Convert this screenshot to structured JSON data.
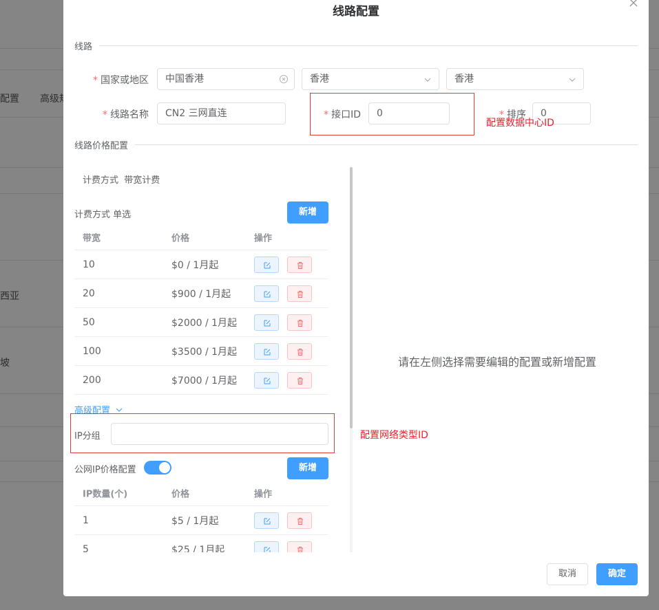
{
  "background": {
    "texts": [
      "配置",
      "高级规",
      "西亚",
      "坡"
    ]
  },
  "modal": {
    "title": "线路配置",
    "section_route": "线路",
    "section_price": "线路价格配置",
    "country_label": "国家或地区",
    "country_value": "中国香港",
    "region_value": "香港",
    "city_value": "香港",
    "route_name_label": "线路名称",
    "route_name_value": "CN2 三网直连",
    "interface_id_label": "接口ID",
    "interface_id_value": "0",
    "sort_label": "排序",
    "sort_value": "0",
    "note_datacenter": "配置数据中心ID",
    "note_network": "配置网络类型ID",
    "billing_mode_label": "计费方式",
    "billing_mode_value": "带宽计费",
    "billing_single_label": "计费方式 单选",
    "add_label": "新增",
    "bandwidth_table": {
      "headers": [
        "带宽",
        "价格",
        "操作"
      ],
      "rows": [
        {
          "bw": "10",
          "price": "$0 / 1月起"
        },
        {
          "bw": "20",
          "price": "$900 / 1月起"
        },
        {
          "bw": "50",
          "price": "$2000 / 1月起"
        },
        {
          "bw": "100",
          "price": "$3500 / 1月起"
        },
        {
          "bw": "200",
          "price": "$7000 / 1月起"
        }
      ]
    },
    "advanced_label": "高级配置",
    "ip_group_label": "IP分组",
    "ip_group_value": "",
    "public_ip_label": "公网IP价格配置",
    "ip_table": {
      "headers": [
        "IP数量(个)",
        "价格",
        "操作"
      ],
      "rows": [
        {
          "count": "1",
          "price": "$5 / 1月起"
        },
        {
          "count": "5",
          "price": "$25 / 1月起"
        }
      ]
    },
    "right_placeholder": "请在左侧选择需要编辑的配置或新增配置",
    "cancel_label": "取消",
    "confirm_label": "确定"
  },
  "colors": {
    "primary": "#409eff",
    "danger": "#f56c6c",
    "annotation": "#e8232b"
  }
}
